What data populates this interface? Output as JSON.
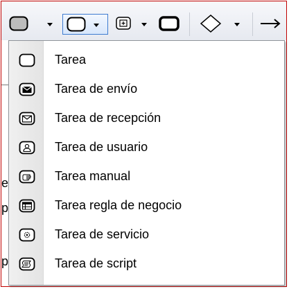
{
  "menu": {
    "items": [
      {
        "label": "Tarea",
        "icon": "task-icon"
      },
      {
        "label": "Tarea de envío",
        "icon": "send-task-icon"
      },
      {
        "label": "Tarea de recepción",
        "icon": "receive-task-icon"
      },
      {
        "label": "Tarea de usuario",
        "icon": "user-task-icon"
      },
      {
        "label": "Tarea manual",
        "icon": "manual-task-icon"
      },
      {
        "label": "Tarea regla de negocio",
        "icon": "business-rule-task-icon"
      },
      {
        "label": "Tarea de servicio",
        "icon": "service-task-icon"
      },
      {
        "label": "Tarea de script",
        "icon": "script-task-icon"
      }
    ]
  },
  "background": {
    "clipped_chars": [
      "e",
      "p",
      "p"
    ]
  },
  "colors": {
    "frame_border": "#c00000",
    "active_border": "#3d7bd0"
  }
}
